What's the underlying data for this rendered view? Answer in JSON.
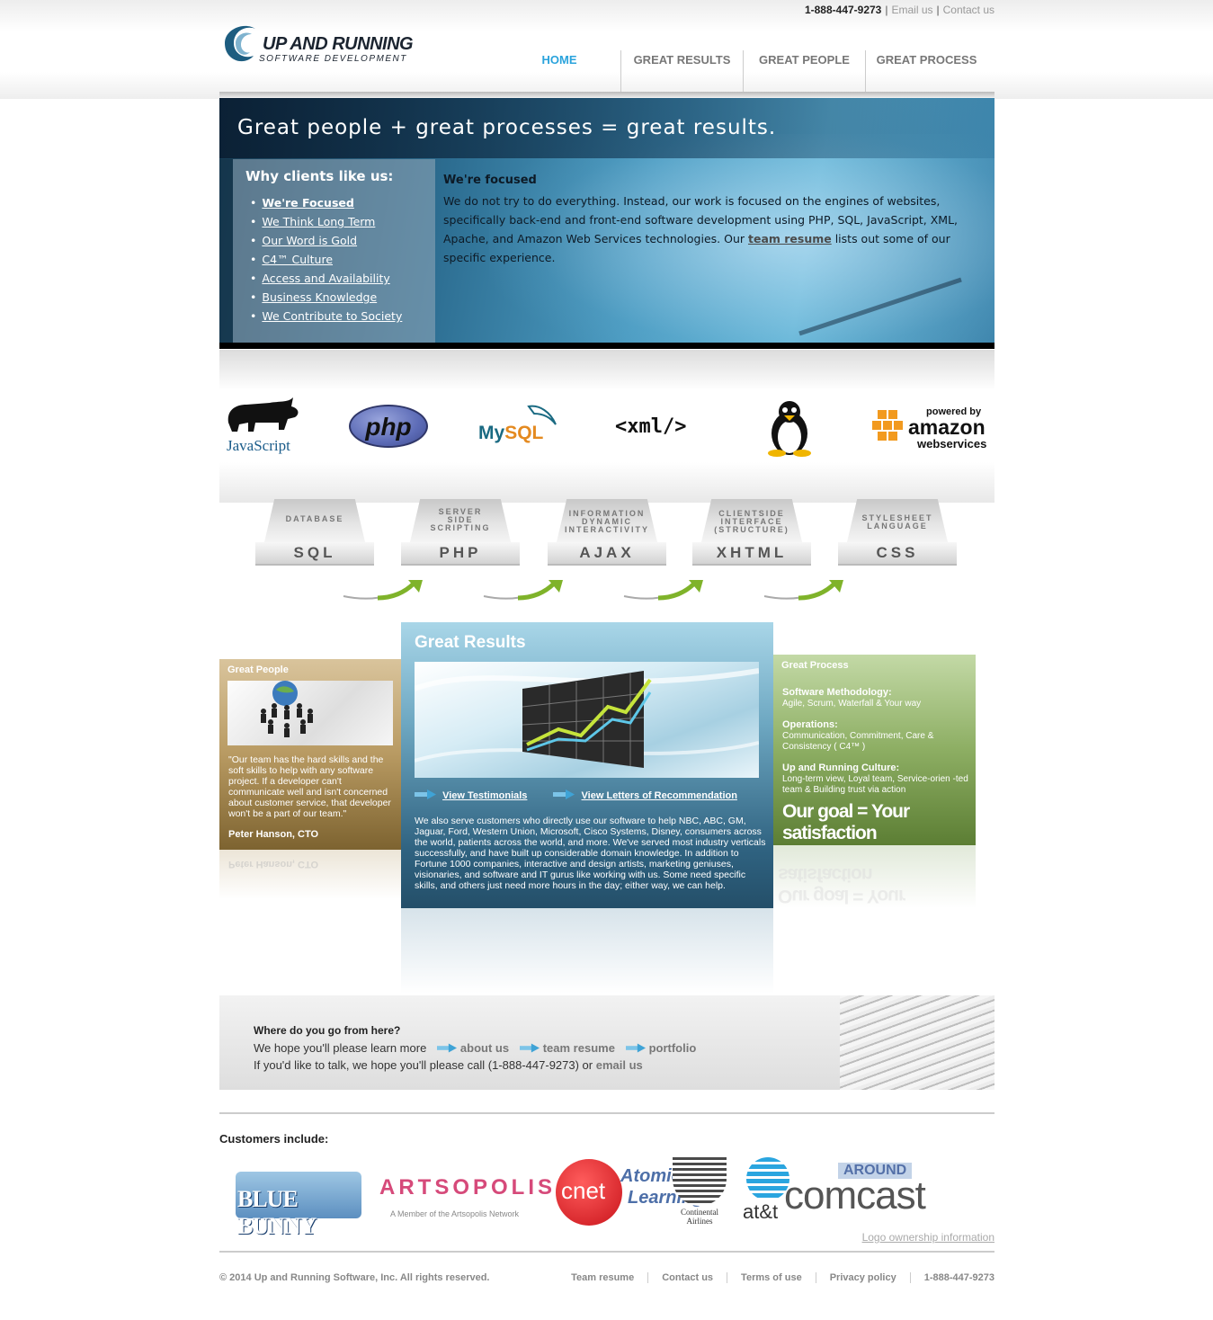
{
  "topbar": {
    "phone": "1-888-447-9273",
    "email": "Email us",
    "contact": "Contact us"
  },
  "logo": {
    "line1": "UP AND RUNNING",
    "line2": "SOFTWARE DEVELOPMENT"
  },
  "nav": [
    "HOME",
    "GREAT RESULTS",
    "GREAT PEOPLE",
    "GREAT PROCESS"
  ],
  "hero": {
    "title": "Great people  +  great processes  =  great results.",
    "why_title": "Why clients like us:",
    "items": [
      "We're Focused",
      "We Think Long Term",
      "Our Word is Gold",
      "C4™ Culture",
      "Access and Availability",
      "Business Knowledge",
      "We Contribute to Society"
    ],
    "content_title": "We're focused",
    "content_text_a": "We do not try to do everything. Instead, our work is focused on the engines of websites, specifically back-end and front-end software development using PHP, SQL, JavaScript, XML, Apache, and Amazon Web Services technologies. Our ",
    "content_link": "team resume",
    "content_text_b": " lists out some of our specific experience."
  },
  "tech": {
    "js": "JavaScript",
    "php": "php",
    "mysql_a": "My",
    "mysql_b": "SQL",
    "xml": "<xml/>",
    "aws_powered": "powered by",
    "aws_amazon": "amazon",
    "aws_ws": "webservices"
  },
  "skills": [
    {
      "small": [
        "DATABASE"
      ],
      "big": "SQL"
    },
    {
      "small": [
        "SERVER",
        "SIDE",
        "SCRIPTING"
      ],
      "big": "PHP"
    },
    {
      "small": [
        "INFORMATION",
        "DYNAMIC",
        "INTERACTIVITY"
      ],
      "big": "AJAX"
    },
    {
      "small": [
        "CLIENTSIDE",
        "INTERFACE",
        "(STRUCTURE)"
      ],
      "big": "XHTML"
    },
    {
      "small": [
        "STYLESHEET",
        "LANGUAGE"
      ],
      "big": "CSS"
    }
  ],
  "people": {
    "heading": "Great People",
    "quote": "\"Our team has the hard skills and the soft skills to help with any software project. If a developer can't communicate well and isn't concerned about customer service, that developer won't be a part of our team.\"",
    "author": "Peter Hanson, CTO"
  },
  "results": {
    "heading": "Great Results",
    "link1": "View Testimonials",
    "link2": "View Letters of Recommendation",
    "body": "We also serve customers who directly use our software to help NBC, ABC, GM, Jaguar, Ford, Western Union, Microsoft, Cisco Systems, Disney, consumers across the world, patients across the world, and more. We've served most industry verticals successfully, and have built up considerable domain knowledge. In addition to Fortune 1000 companies, interactive and design artists, marketing geniuses, visionaries, and software and IT gurus like working with us. Some need specific skills, and others just need more hours in the day; either way, we can help."
  },
  "process": {
    "heading": "Great Process",
    "blocks": [
      {
        "title": "Software Methodology:",
        "text": "Agile, Scrum, Waterfall & Your way"
      },
      {
        "title": "Operations:",
        "text": "Communication, Commitment, Care & Consistency ( C4™ )"
      },
      {
        "title": "Up and Running Culture:",
        "text": "Long-term view, Loyal team, Service-orien -ted team & Building trust via action"
      }
    ],
    "goal": "Our goal = Your satisfaction"
  },
  "where": {
    "question": "Where do you go from here?",
    "line1_pre": "We hope you'll please learn more",
    "link_about": "about us",
    "link_resume": "team resume",
    "link_portfolio": "portfolio",
    "line2_pre": "If you'd like to talk, we hope you'll please call (1-888-447-9273) or ",
    "link_email": "email us"
  },
  "customers": {
    "title": "Customers include:",
    "logos": {
      "bluebunny": "BLUE BUNNY",
      "artsopolis": "ARTSOPOLIS",
      "artsopolis_sub": "A Member of the Artsopolis Network",
      "cnet": "cnet",
      "atomic": "Atomic",
      "atomic2": "Learning",
      "continental": "Continental Airlines",
      "att": "at&t",
      "comcast": "comcast",
      "around": "AROUND"
    },
    "ownership_link": "Logo ownership information"
  },
  "footer": {
    "copyright": "© 2014 Up and Running Software, Inc. All rights reserved.",
    "links": [
      "Team resume",
      "Contact us",
      "Terms of use",
      "Privacy policy",
      "1-888-447-9273"
    ]
  },
  "colors": {
    "nav_active": "#2aa3dc",
    "people_bg": "#b89a62",
    "results_bg": "#6ea8c2",
    "process_bg": "#8dae63"
  }
}
